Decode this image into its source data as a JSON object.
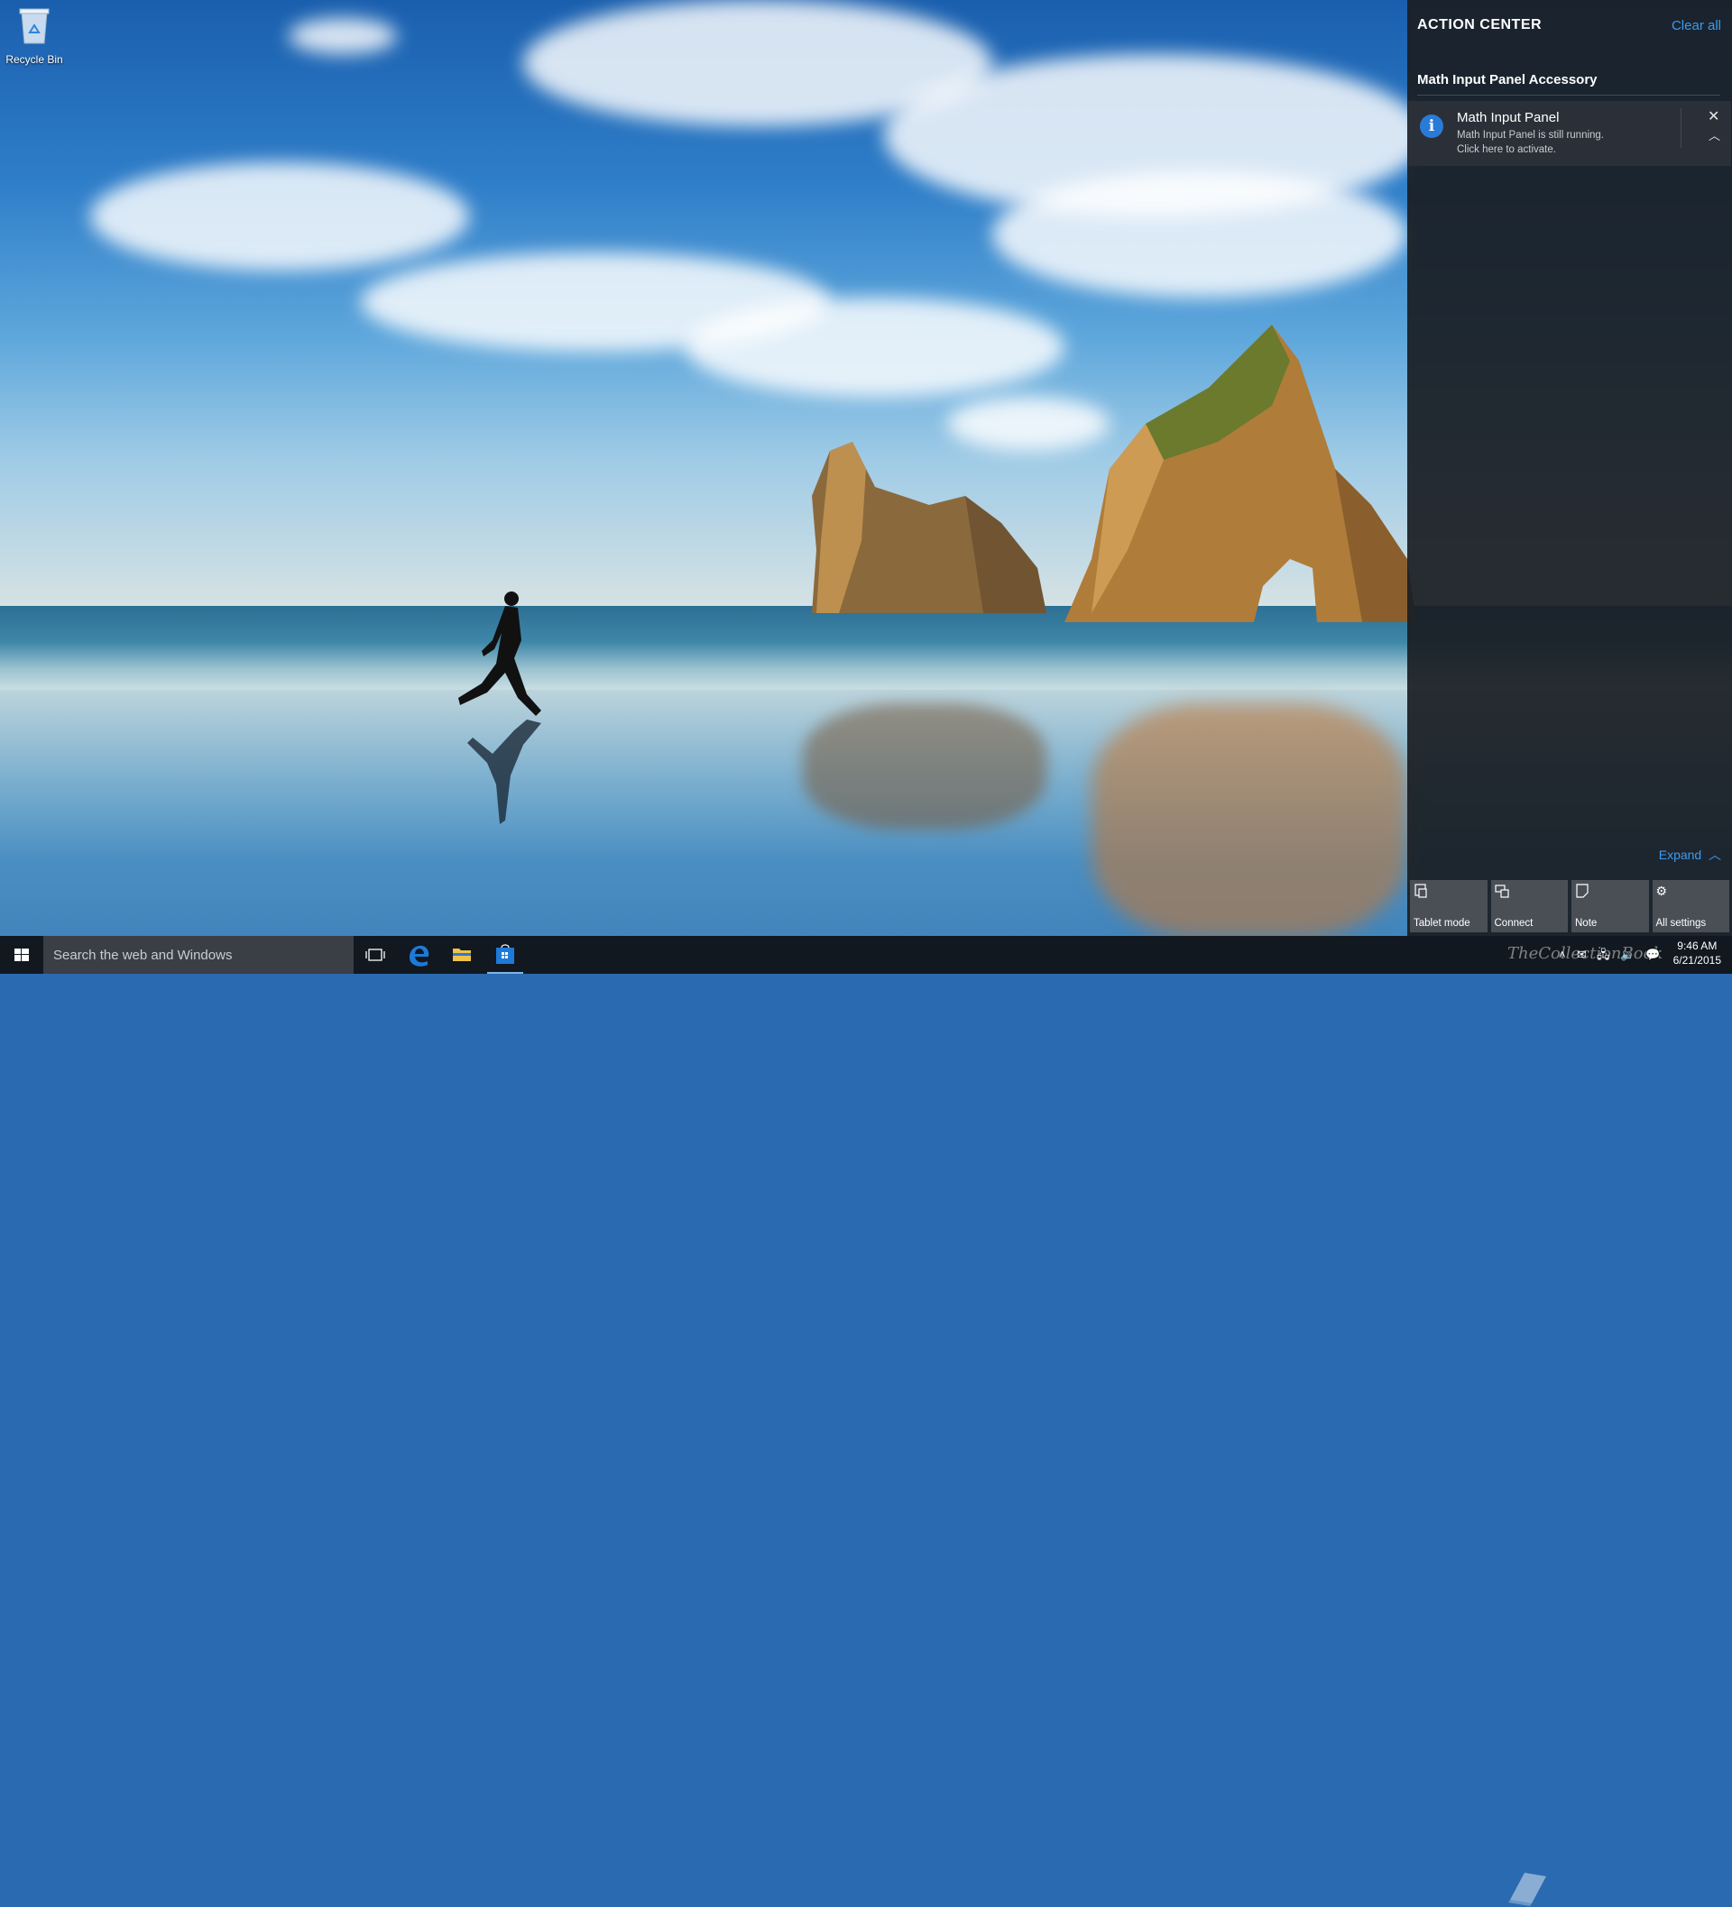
{
  "desktop": {
    "icons": [
      {
        "label": "Recycle Bin",
        "icon": "recycle-bin-icon"
      }
    ]
  },
  "action_center": {
    "title": "ACTION CENTER",
    "clear_all": "Clear all",
    "groups": [
      {
        "title": "Math Input Panel Accessory",
        "notifications": [
          {
            "icon": "info-icon",
            "title": "Math Input Panel",
            "body_line1": "Math Input Panel is still running.",
            "body_line2": "Click here to activate."
          }
        ]
      }
    ],
    "expand_label": "Expand",
    "quick_actions": [
      {
        "label": "Tablet mode",
        "icon": "tablet-mode-icon"
      },
      {
        "label": "Connect",
        "icon": "connect-icon"
      },
      {
        "label": "Note",
        "icon": "note-icon"
      },
      {
        "label": "All settings",
        "icon": "gear-icon"
      }
    ]
  },
  "taskbar": {
    "search_placeholder": "Search the web and Windows",
    "pinned": [
      {
        "name": "task-view",
        "icon": "task-view-icon"
      },
      {
        "name": "edge",
        "icon": "edge-icon"
      },
      {
        "name": "file-explorer",
        "icon": "folder-icon"
      },
      {
        "name": "store",
        "icon": "store-icon"
      }
    ],
    "tray": {
      "time": "9:46 AM",
      "date": "6/21/2015"
    }
  },
  "watermark": "TheCollectionBook",
  "colors": {
    "accent": "#3b9bf0",
    "action_center_bg": "#1a1e24",
    "notification_bg": "#2b3038",
    "tile_bg": "#4a4f56",
    "taskbar_bg": "#10141a"
  }
}
